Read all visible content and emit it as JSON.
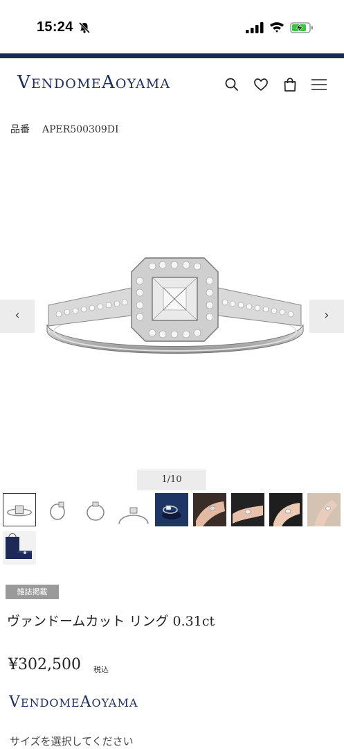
{
  "status_bar": {
    "time": "15:24",
    "icons": [
      "bell-muted-icon",
      "signal-icon",
      "wifi-icon",
      "battery-charging-icon"
    ]
  },
  "colors": {
    "brand_navy": "#1b2a55",
    "logo_text": "#1d2d5c",
    "badge_bg": "#9a9a9a",
    "nav_bg": "#ececec",
    "battery_green": "#3dc43d"
  },
  "header": {
    "logo_v": "V",
    "logo_endome": "ENDOME",
    "logo_a": "A",
    "logo_oyama": "OYAMA",
    "icons": [
      "search-icon",
      "heart-icon",
      "shopping-bag-icon",
      "hamburger-menu-icon"
    ]
  },
  "product": {
    "sku_label": "品番",
    "sku": "APER500309DI",
    "gallery_counter": "1/10",
    "prev_label": "‹",
    "next_label": "›",
    "badge": "雑誌掲載",
    "title": "ヴァンドームカット リング 0.31ct",
    "price": "¥302,500",
    "tax_label": "税込",
    "size_prompt": "サイズを選択してください"
  },
  "footer_logo": {
    "v": "V",
    "endome": "ENDOME",
    "a": "A",
    "oyama": "OYAMA"
  },
  "thumbnails": [
    "ring-front",
    "ring-side-angle",
    "ring-side",
    "ring-profile",
    "ring-on-dark-blue",
    "ring-on-hand",
    "ring-on-hand-2",
    "ring-on-finger",
    "ring-worn-beige",
    "gift-box-bag"
  ]
}
